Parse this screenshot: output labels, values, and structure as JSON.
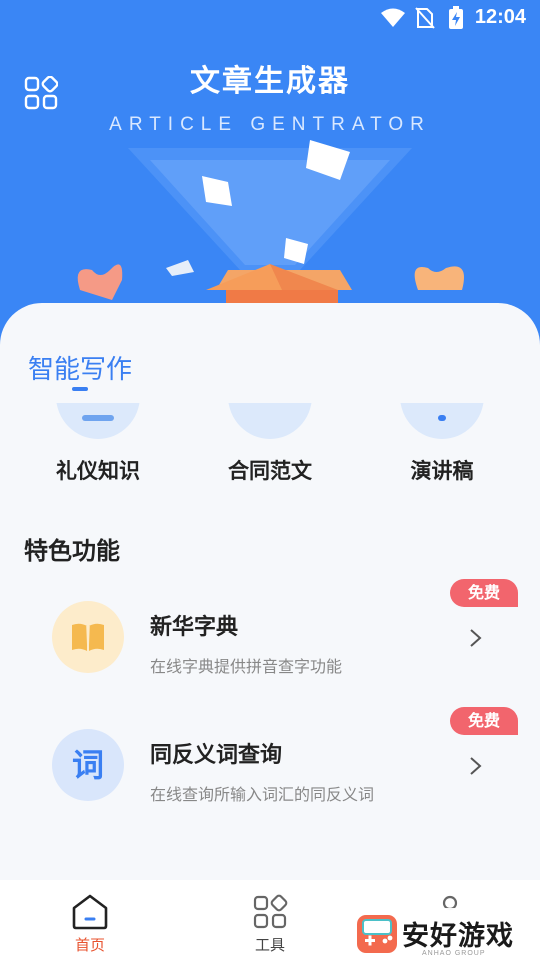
{
  "status_bar": {
    "time": "12:04"
  },
  "header": {
    "title": "文章生成器",
    "subtitle": "ARTICLE GENTRATOR",
    "menu_icon": "grid-menu-icon"
  },
  "writing": {
    "tab_label": "智能写作",
    "shortcuts": [
      {
        "label": "礼仪知识"
      },
      {
        "label": "合同范文"
      },
      {
        "label": "演讲稿"
      }
    ]
  },
  "features": {
    "title": "特色功能",
    "items": [
      {
        "name": "新华字典",
        "desc": "在线字典提供拼音查字功能",
        "badge": "免费",
        "icon": "book-icon"
      },
      {
        "name": "同反义词查询",
        "desc": "在线查询所输入词汇的同反义词",
        "badge": "免费",
        "icon": "ci-character-icon",
        "icon_text": "词"
      }
    ]
  },
  "bottom_nav": {
    "items": [
      {
        "label": "首页",
        "active": true
      },
      {
        "label": "工具",
        "active": false
      }
    ]
  },
  "watermark": {
    "text": "安好游戏",
    "sub": "ANHAO GROUP"
  },
  "colors": {
    "primary": "#3a86f5",
    "accent_red": "#f2656d",
    "nav_active": "#e8532f"
  }
}
